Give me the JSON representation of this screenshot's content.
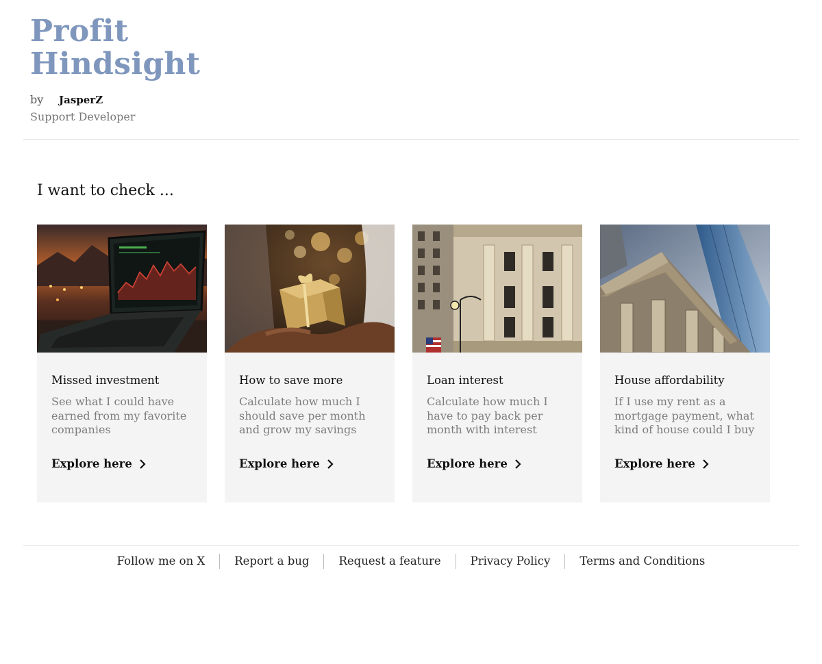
{
  "site": {
    "title_line1": "Profit",
    "title_line2": "Hindsight",
    "by_label": "by",
    "author": "JasperZ",
    "support_label": "Support Developer"
  },
  "colors": {
    "title": "#7f97bd",
    "card_bg": "#f4f4f4",
    "muted_text": "#7d7d7d"
  },
  "main": {
    "heading": "I want to check ...",
    "cards": [
      {
        "title": "Missed investment",
        "description": "See what I could have earned from my favorite companies",
        "link": "Explore here",
        "image": "laptop-stock-chart-image"
      },
      {
        "title": "How to save more",
        "description": "Calculate how much I should save per month and grow my savings",
        "link": "Explore here",
        "image": "gift-box-image"
      },
      {
        "title": "Loan interest",
        "description": "Calculate how much I have to pay back per month with interest",
        "link": "Explore here",
        "image": "bank-building-image"
      },
      {
        "title": "House affordability",
        "description": "If I use my rent as a mortgage payment, what kind of house could I buy",
        "link": "Explore here",
        "image": "skyscraper-columns-image"
      }
    ]
  },
  "footer": {
    "links": [
      "Follow me on X",
      "Report a bug",
      "Request a feature",
      "Privacy Policy",
      "Terms and Conditions"
    ]
  }
}
